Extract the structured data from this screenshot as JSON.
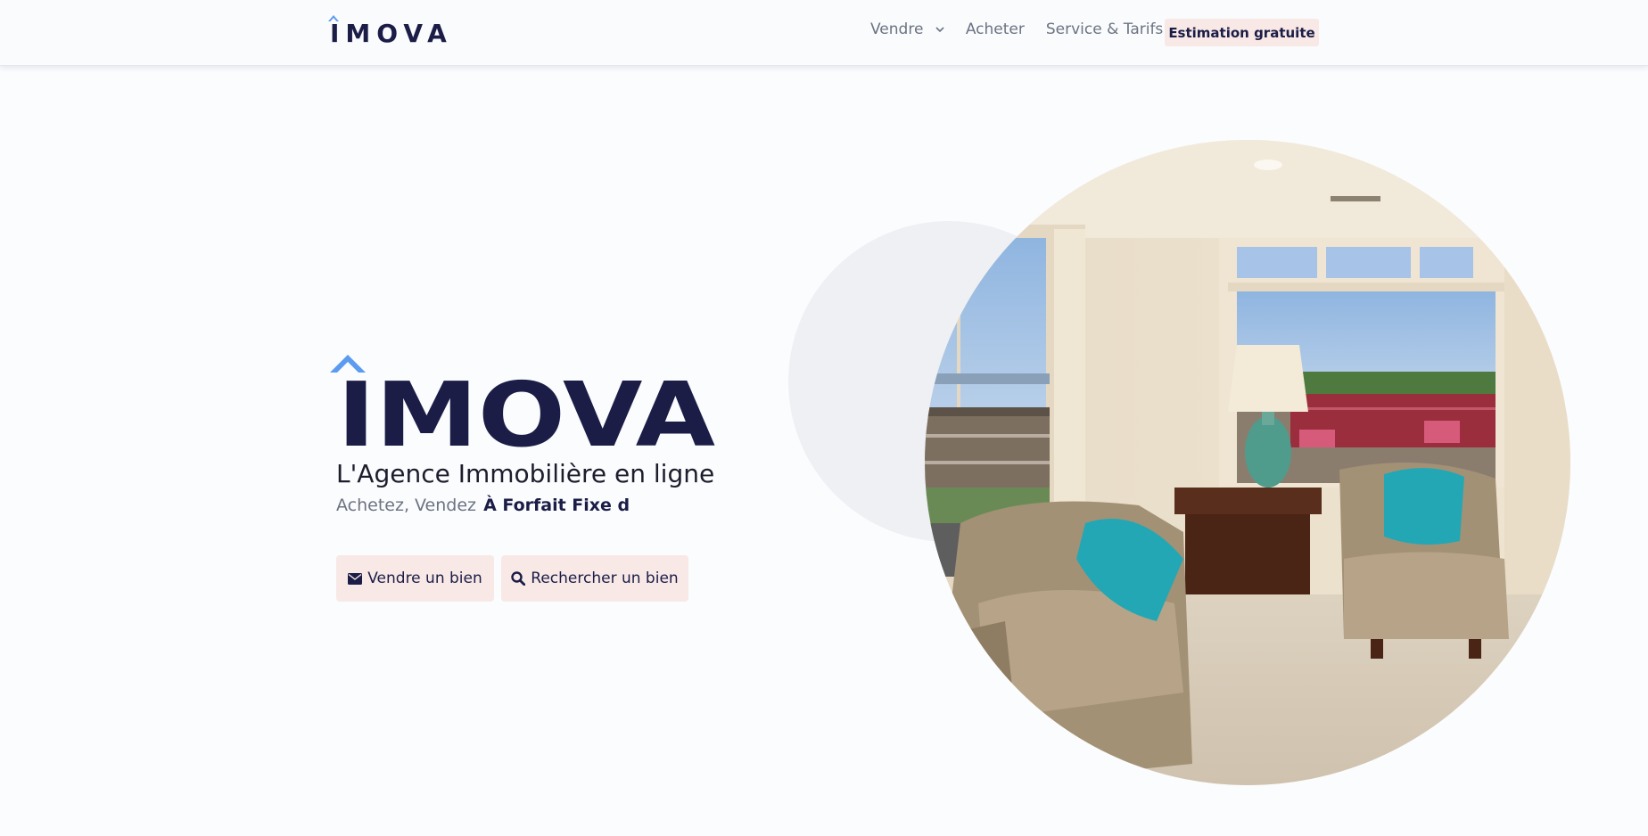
{
  "brand": {
    "name": "IMOVA",
    "colors": {
      "navy": "#1b1d47",
      "accent_blue": "#5b9bf0",
      "button_bg": "#f8e8e6",
      "text_muted": "#6b7382"
    }
  },
  "nav": {
    "logo_text": "IMOVA",
    "links": [
      {
        "label": "Vendre",
        "has_dropdown": true,
        "icon": "chevron-down-icon"
      },
      {
        "label": "Acheter"
      },
      {
        "label": "Service & Tarifs"
      }
    ],
    "cta_label": "Estimation gratuite"
  },
  "hero": {
    "logo_text": "IMOVA",
    "subtitle": "L'Agence Immobilière en ligne",
    "tagline_prefix": "Achetez, Vendez",
    "tagline_highlight": "À Forfait Fixe d",
    "buttons": [
      {
        "label": "Vendre un bien",
        "icon": "envelope-icon"
      },
      {
        "label": "Rechercher un bien",
        "icon": "search-icon"
      }
    ]
  }
}
